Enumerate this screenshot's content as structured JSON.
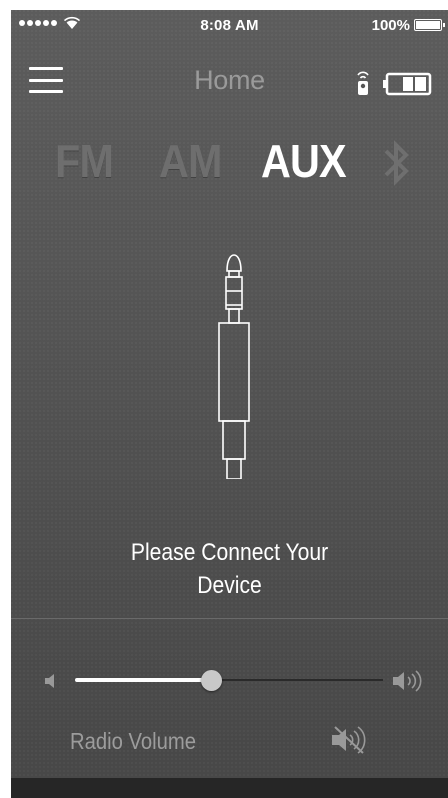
{
  "status_bar": {
    "time": "8:08 AM",
    "battery_percent": "100%",
    "signal_bars": 5,
    "battery_level": 1.0
  },
  "nav": {
    "title": "Home",
    "icons": [
      "menu-icon",
      "remote-icon",
      "device-battery-icon"
    ]
  },
  "sources": {
    "tabs": [
      {
        "label": "FM",
        "active": false
      },
      {
        "label": "AM",
        "active": false
      },
      {
        "label": "AUX",
        "active": true
      }
    ],
    "bluetooth_icon": "bluetooth-icon"
  },
  "aux_screen": {
    "icon": "audio-jack-icon",
    "message_line1": "Please Connect Your",
    "message_line2": "Device"
  },
  "volume": {
    "label": "Radio Volume",
    "level": 0.44,
    "mute_icon": "mute-icon"
  },
  "colors": {
    "background": "#555555",
    "active_tab": "#ffffff",
    "inactive_tab": "#6e6e6e",
    "title": "#9a9a9a"
  }
}
